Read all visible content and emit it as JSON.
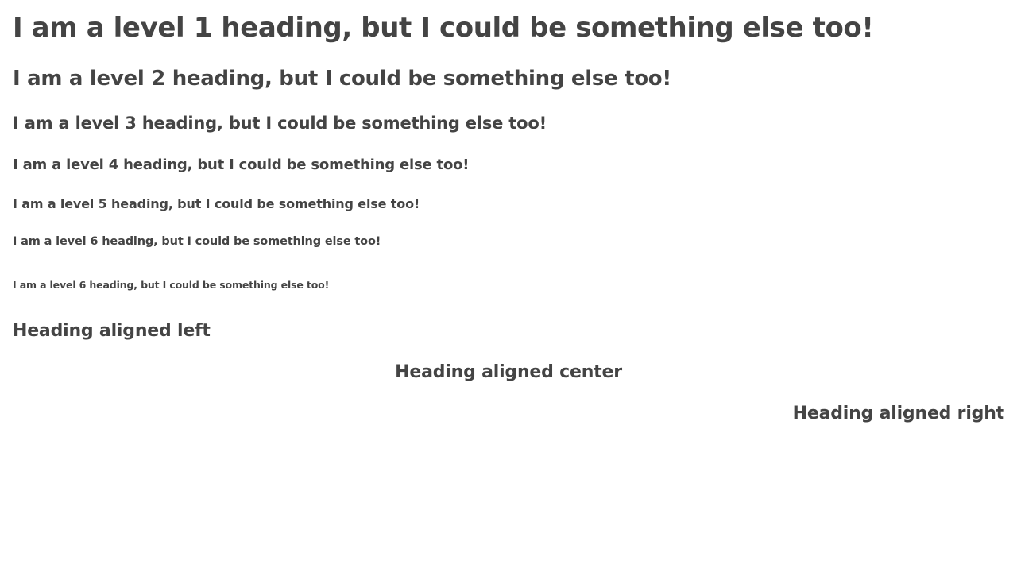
{
  "headings": {
    "h1": "I am a level 1 heading, but I could be something else too!",
    "h2": "I am a level 2 heading, but I could be something else too!",
    "h3": "I am a level 3 heading, but I could be something else too!",
    "h4": "I am a level 4 heading, but I could be something else too!",
    "h5": "I am a level 5 heading, but I could be something else too!",
    "h6": "I am a level 6 heading, but I could be something else too!",
    "h6_small": "I am a level 6 heading, but I could be something else too!"
  },
  "alignment": {
    "left": "Heading aligned left",
    "center": "Heading aligned center",
    "right": "Heading aligned right"
  },
  "colors": {
    "text": "#444444",
    "background": "#ffffff"
  }
}
